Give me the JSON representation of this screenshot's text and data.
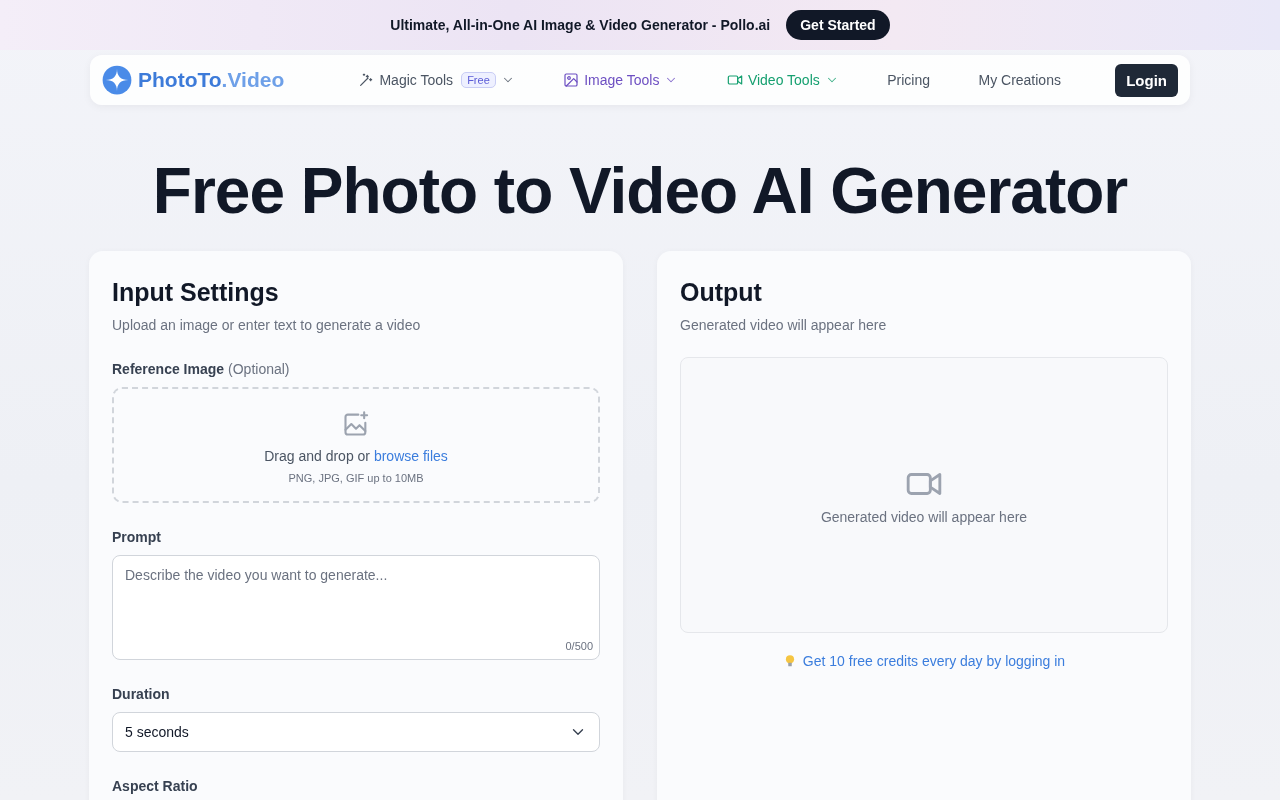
{
  "banner": {
    "text": "Ultimate, All-in-One AI Image & Video Generator - Pollo.ai",
    "button": "Get Started"
  },
  "nav": {
    "logo_a": "PhotoTo",
    "logo_b": ".Video",
    "items": [
      {
        "label": "Magic Tools",
        "kind": "magic",
        "badge": "Free",
        "dropdown": true,
        "color": "#4b5563"
      },
      {
        "label": "Image Tools",
        "kind": "image",
        "dropdown": true,
        "color": "#6d4fc2"
      },
      {
        "label": "Video Tools",
        "kind": "video",
        "dropdown": true,
        "color": "#16a070"
      },
      {
        "label": "Pricing",
        "kind": "plain",
        "dropdown": false,
        "color": "#4b5563"
      },
      {
        "label": "My Creations",
        "kind": "plain",
        "dropdown": false,
        "color": "#4b5563"
      }
    ],
    "login": "Login"
  },
  "title": "Free Photo to Video AI Generator",
  "input": {
    "heading": "Input Settings",
    "subtitle": "Upload an image or enter text to generate a video",
    "reference_label": "Reference Image",
    "reference_hint": "(Optional)",
    "drop_text": "Drag and drop or",
    "drop_link": "browse files",
    "drop_formats": "PNG, JPG, GIF up to 10MB",
    "prompt_label": "Prompt",
    "prompt_placeholder": "Describe the video you want to generate...",
    "prompt_count": "0/500",
    "duration_label": "Duration",
    "duration_value": "5 seconds",
    "aspect_label": "Aspect Ratio"
  },
  "output": {
    "heading": "Output",
    "subtitle": "Generated video will appear here",
    "empty_text": "Generated video will appear here",
    "tip": "Get 10 free credits every day by logging in"
  }
}
